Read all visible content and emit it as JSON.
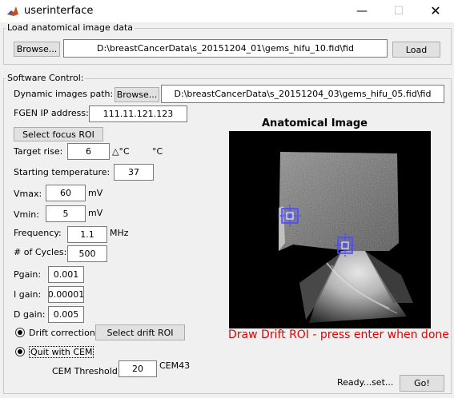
{
  "window": {
    "title": "userinterface",
    "min_glyph": "—",
    "max_glyph": "☐",
    "close_glyph": "✕"
  },
  "load_group": {
    "title": "Load anatomical image data",
    "browse_label": "Browse...",
    "path": "D:\\breastCancerData\\s_20151204_01\\gems_hifu_10.fid\\fid",
    "load_label": "Load"
  },
  "software": {
    "title": "Software Control:",
    "dyn_label": "Dynamic images path:",
    "dyn_browse": "Browse...",
    "dyn_path": "D:\\breastCancerData\\s_20151204_03\\gems_hifu_05.fid\\fid",
    "fgen_label": "FGEN IP address:",
    "fgen_value": "111.11.121.123",
    "focus_roi": "Select focus ROI",
    "target_rise_label": "Target rise:",
    "target_rise_value": "6",
    "target_rise_unit1": "△°C",
    "target_rise_unit2": "°C",
    "start_temp_label": "Starting temperature:",
    "start_temp_value": "37",
    "vmax_label": "Vmax:",
    "vmax_value": "60",
    "vmax_unit": "mV",
    "vmin_label": "Vmin:",
    "vmin_value": "5",
    "vmin_unit": "mV",
    "freq_label": "Frequency:",
    "freq_value": "1.1",
    "freq_unit": "MHz",
    "cycles_label": "# of Cycles:",
    "cycles_value": "500",
    "pgain_label": "Pgain:",
    "pgain_value": "0.001",
    "igain_label": "I gain:",
    "igain_value": "0.00001",
    "dgain_label": "D gain:",
    "dgain_value": "0.005",
    "drift_label": "Drift correction",
    "drift_selected": true,
    "drift_roi": "Select drift ROI",
    "cem_label": "Quit with CEM",
    "cem_selected": true,
    "cem_thresh_label": "CEM Threshold:",
    "cem_thresh_value": "20",
    "cem_unit": "CEM43",
    "image_title": "Anatomical Image",
    "drift_message": "Draw Drift ROI - press enter when done",
    "status": "Ready...set...",
    "go_label": "Go!"
  },
  "colors": {
    "message": "#e60000",
    "roi_marker": "#4a4aff"
  }
}
